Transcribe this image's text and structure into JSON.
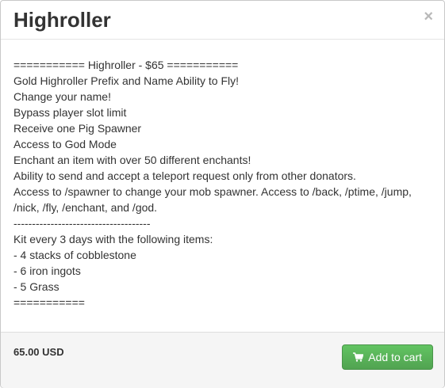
{
  "modal": {
    "title": "Highroller",
    "close_symbol": "×"
  },
  "description": {
    "lines": [
      "=========== Highroller - $65 ===========",
      "Gold Highroller Prefix and Name Ability to Fly!",
      "Change your name!",
      "Bypass player slot limit",
      "Receive one Pig Spawner",
      "Access to God Mode",
      "Enchant an item with over 50 different enchants!",
      "Ability to send and accept a teleport request only from other donators.",
      "Access to /spawner to change your mob spawner. Access to /back, /ptime, /jump, /nick, /fly, /enchant, and /god.",
      "-------------------------------------",
      "Kit every 3 days with the following items:",
      "- 4 stacks of cobblestone",
      "- 6 iron ingots",
      "- 5 Grass",
      "==========="
    ]
  },
  "footer": {
    "price": "65.00 USD",
    "add_to_cart_label": "Add to cart",
    "add_to_cart_icon": "shopping-cart-icon"
  },
  "colors": {
    "button_green": "#5bb75b",
    "footer_bg": "#f5f5f5"
  }
}
